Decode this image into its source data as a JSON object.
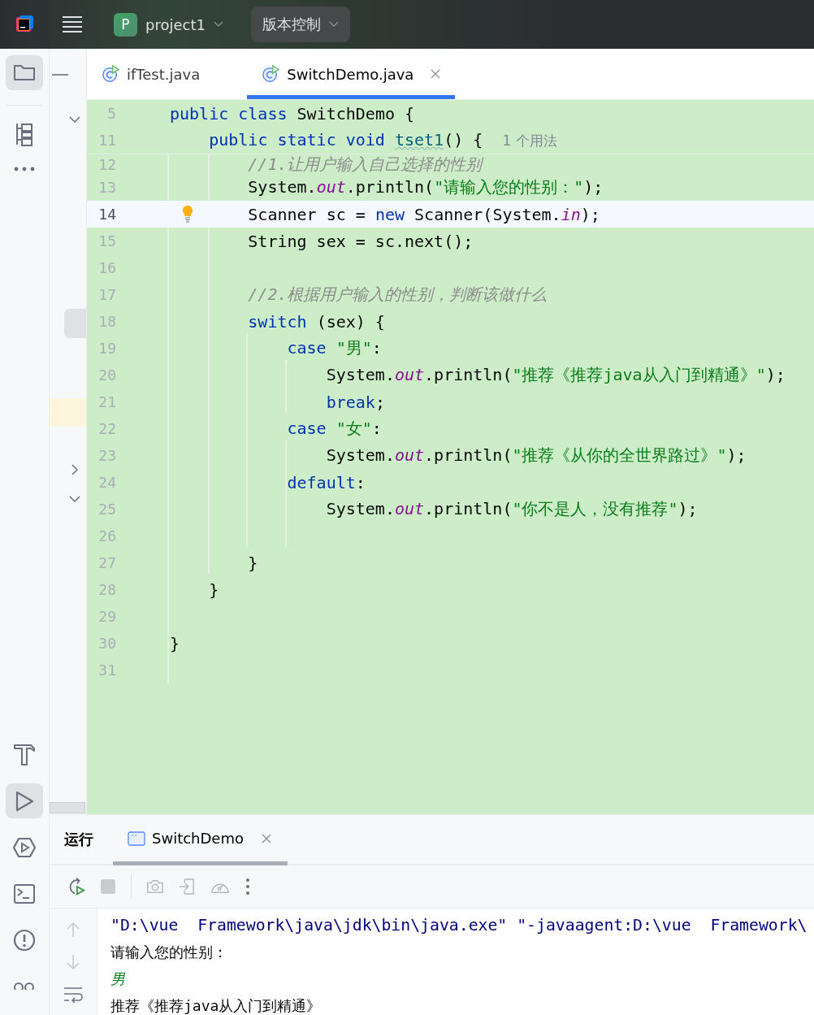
{
  "toolbar": {
    "project": {
      "initial": "P",
      "name": "project1"
    },
    "vcs": "版本控制"
  },
  "tool_strip": [
    {
      "kind": "folder",
      "selected": true
    },
    {
      "kind": "structure",
      "selected": false
    },
    {
      "kind": "more",
      "selected": false
    },
    {
      "kind": "build",
      "selected": false
    },
    {
      "kind": "run",
      "selected": true
    },
    {
      "kind": "services",
      "selected": false
    },
    {
      "kind": "terminal",
      "selected": false
    },
    {
      "kind": "problems",
      "selected": false
    },
    {
      "kind": "people",
      "selected": false
    }
  ],
  "tabs": [
    {
      "label": "ifTest.java",
      "selected": false,
      "closable": false
    },
    {
      "label": "SwitchDemo.java",
      "selected": true,
      "closable": true
    }
  ],
  "editor": {
    "sticky_lines": [
      {
        "number": "5",
        "tokens": [
          {
            "kind": "kw",
            "text": "public class "
          },
          {
            "kind": "plain",
            "text": "SwitchDemo {"
          }
        ]
      },
      {
        "number": "11",
        "tokens": [
          {
            "kind": "kw",
            "text": "    public static void "
          },
          {
            "kind": "method",
            "text": "tset1"
          },
          {
            "kind": "plain",
            "text": "() {  "
          },
          {
            "kind": "hint",
            "text": "1 个用法"
          }
        ]
      }
    ],
    "lines": [
      {
        "number": "12",
        "clipped": true,
        "current": false,
        "intention": false,
        "tokens": [
          {
            "kind": "comment",
            "text": "        //1.让用户输入自己选择的性别"
          }
        ]
      },
      {
        "number": "13",
        "clipped": false,
        "current": false,
        "intention": false,
        "tokens": [
          {
            "kind": "plain",
            "text": "        System."
          },
          {
            "kind": "field",
            "text": "out"
          },
          {
            "kind": "plain",
            "text": ".println("
          },
          {
            "kind": "str",
            "text": "\"请输入您的性别：\""
          },
          {
            "kind": "plain",
            "text": ");"
          }
        ]
      },
      {
        "number": "14",
        "clipped": false,
        "current": true,
        "intention": true,
        "tokens": [
          {
            "kind": "plain",
            "text": "        Scanner sc = "
          },
          {
            "kind": "kw",
            "text": "new "
          },
          {
            "kind": "plain",
            "text": "Scanner(System."
          },
          {
            "kind": "field",
            "text": "in"
          },
          {
            "kind": "plain",
            "text": ");"
          }
        ]
      },
      {
        "number": "15",
        "clipped": false,
        "current": false,
        "intention": false,
        "tokens": [
          {
            "kind": "plain",
            "text": "        String sex = sc.next();"
          }
        ]
      },
      {
        "number": "16",
        "clipped": false,
        "current": false,
        "intention": false
      },
      {
        "number": "17",
        "clipped": false,
        "current": false,
        "intention": false,
        "tokens": [
          {
            "kind": "comment",
            "text": "        //2.根据用户输入的性别，判断该做什么"
          }
        ]
      },
      {
        "number": "18",
        "clipped": false,
        "current": false,
        "intention": false,
        "tokens": [
          {
            "kind": "kw",
            "text": "        switch "
          },
          {
            "kind": "plain",
            "text": "(sex) {"
          }
        ]
      },
      {
        "number": "19",
        "clipped": false,
        "current": false,
        "intention": false,
        "tokens": [
          {
            "kind": "kw",
            "text": "            case "
          },
          {
            "kind": "str",
            "text": "\"男\""
          },
          {
            "kind": "plain",
            "text": ":"
          }
        ]
      },
      {
        "number": "20",
        "clipped": false,
        "current": false,
        "intention": false,
        "tokens": [
          {
            "kind": "plain",
            "text": "                System."
          },
          {
            "kind": "field",
            "text": "out"
          },
          {
            "kind": "plain",
            "text": ".println("
          },
          {
            "kind": "str",
            "text": "\"推荐《推荐java从入门到精通》\""
          },
          {
            "kind": "plain",
            "text": ");"
          }
        ]
      },
      {
        "number": "21",
        "clipped": false,
        "current": false,
        "intention": false,
        "tokens": [
          {
            "kind": "kw",
            "text": "                break"
          },
          {
            "kind": "plain",
            "text": ";"
          }
        ]
      },
      {
        "number": "22",
        "clipped": false,
        "current": false,
        "intention": false,
        "tokens": [
          {
            "kind": "kw",
            "text": "            case "
          },
          {
            "kind": "str",
            "text": "\"女\""
          },
          {
            "kind": "plain",
            "text": ":"
          }
        ]
      },
      {
        "number": "23",
        "clipped": false,
        "current": false,
        "intention": false,
        "tokens": [
          {
            "kind": "plain",
            "text": "                System."
          },
          {
            "kind": "field",
            "text": "out"
          },
          {
            "kind": "plain",
            "text": ".println("
          },
          {
            "kind": "str",
            "text": "\"推荐《从你的全世界路过》\""
          },
          {
            "kind": "plain",
            "text": ");"
          }
        ]
      },
      {
        "number": "24",
        "clipped": false,
        "current": false,
        "intention": false,
        "tokens": [
          {
            "kind": "kw",
            "text": "            default"
          },
          {
            "kind": "plain",
            "text": ":"
          }
        ]
      },
      {
        "number": "25",
        "clipped": false,
        "current": false,
        "intention": false,
        "tokens": [
          {
            "kind": "plain",
            "text": "                System."
          },
          {
            "kind": "field",
            "text": "out"
          },
          {
            "kind": "plain",
            "text": ".println("
          },
          {
            "kind": "str",
            "text": "\"你不是人，没有推荐\""
          },
          {
            "kind": "plain",
            "text": ");"
          }
        ]
      },
      {
        "number": "26",
        "clipped": false,
        "current": false,
        "intention": false
      },
      {
        "number": "27",
        "clipped": false,
        "current": false,
        "intention": false,
        "tokens": [
          {
            "kind": "plain",
            "text": "        }"
          }
        ]
      },
      {
        "number": "28",
        "clipped": false,
        "current": false,
        "intention": false,
        "tokens": [
          {
            "kind": "plain",
            "text": "    }"
          }
        ]
      },
      {
        "number": "29",
        "clipped": false,
        "current": false,
        "intention": false
      },
      {
        "number": "30",
        "clipped": false,
        "current": false,
        "intention": false,
        "tokens": [
          {
            "kind": "plain",
            "text": "}"
          }
        ]
      },
      {
        "number": "31",
        "clipped": false,
        "current": false,
        "intention": false
      }
    ]
  },
  "run_panel": {
    "title": "运行",
    "tabs": [
      {
        "label": "SwitchDemo",
        "selected": true
      }
    ],
    "console": [
      {
        "kind": "command",
        "text": "\"D:\\vue  Framework\\java\\jdk\\bin\\java.exe\" \"-javaagent:D:\\vue  Framework\\"
      },
      {
        "kind": "output",
        "text": "请输入您的性别："
      },
      {
        "kind": "input",
        "text": "男"
      },
      {
        "kind": "output",
        "text": "推荐《推荐java从入门到精通》"
      }
    ]
  }
}
